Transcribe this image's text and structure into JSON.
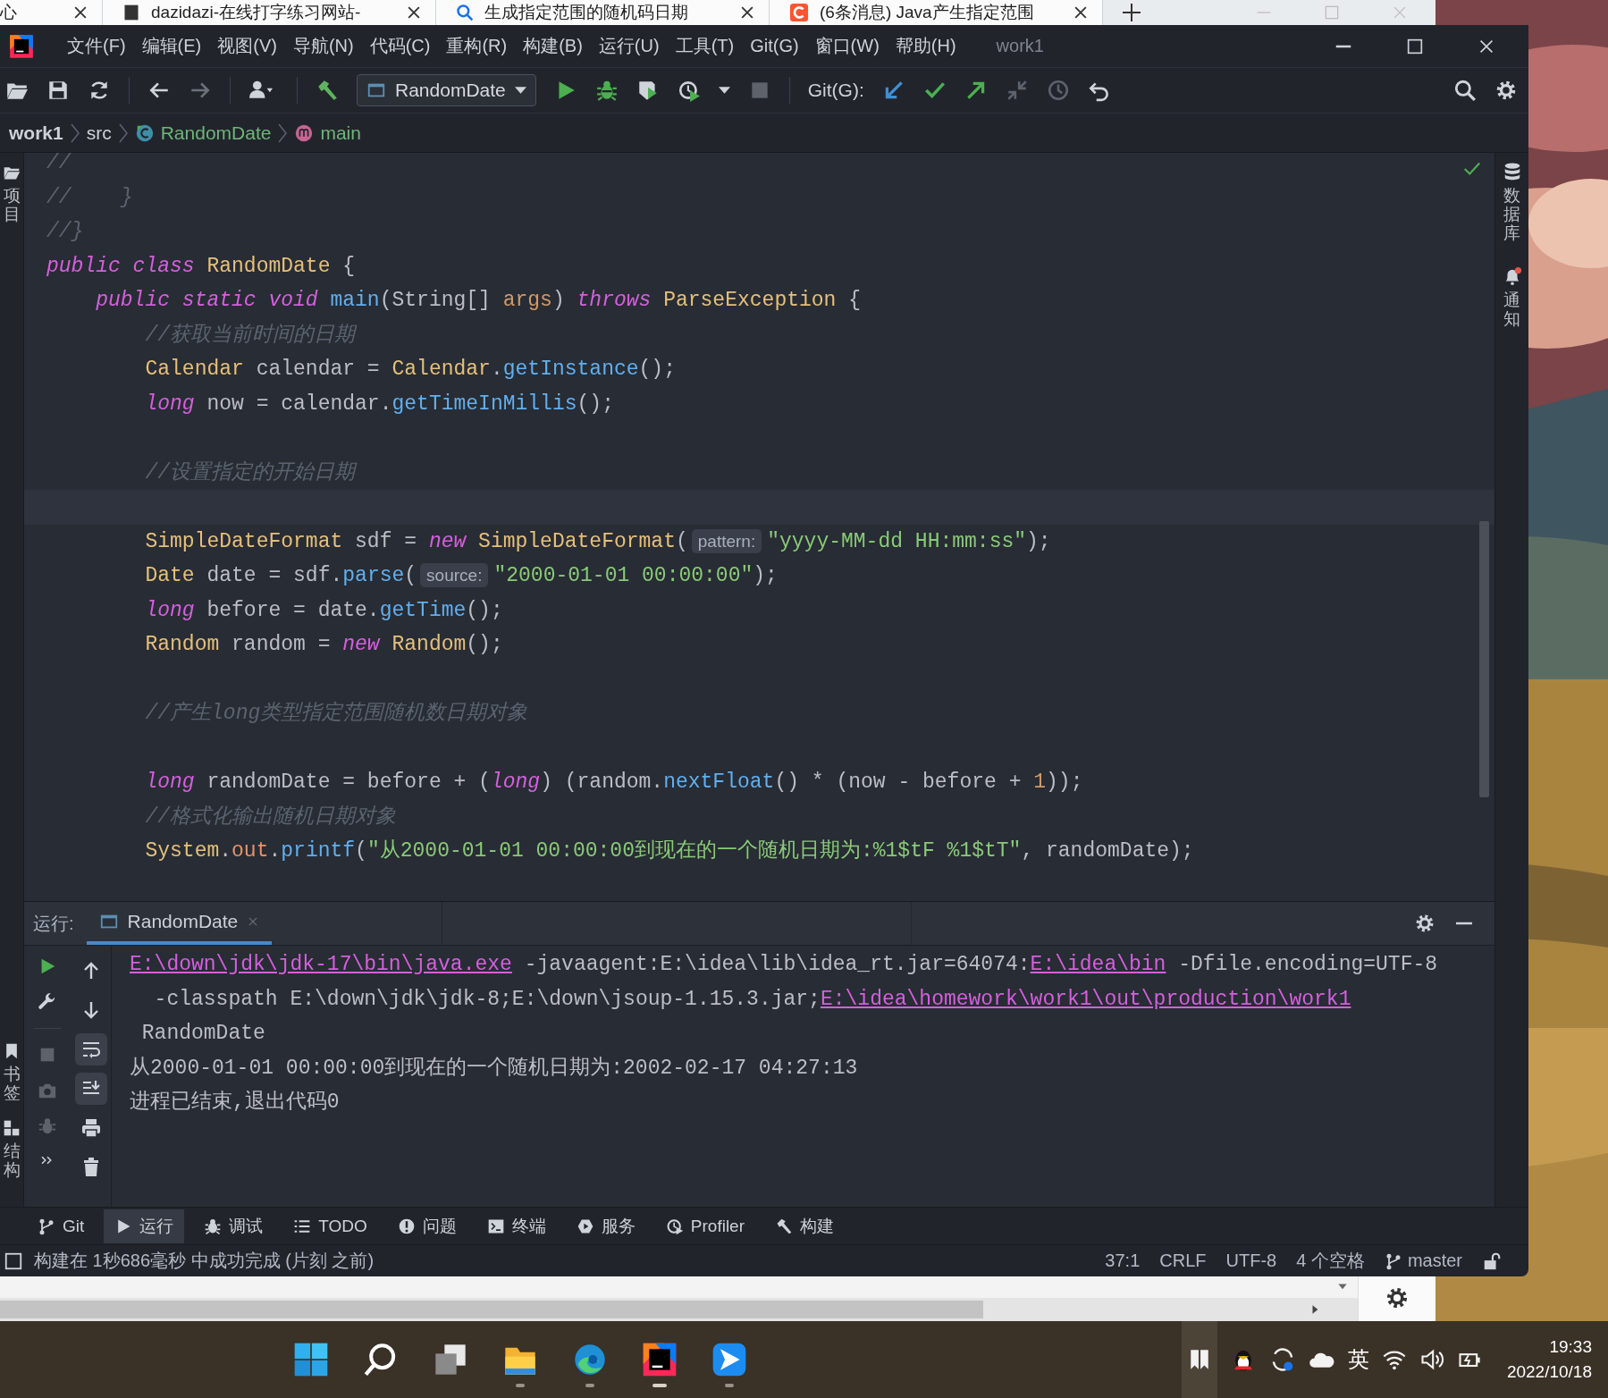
{
  "browser": {
    "tabs": [
      {
        "title": "心",
        "kind": "none"
      },
      {
        "title": "dazidazi-在线打字练习网站-",
        "kind": "page"
      },
      {
        "title": "生成指定范围的随机码日期",
        "kind": "search"
      },
      {
        "title": "(6条消息) Java产生指定范围",
        "kind": "csdn"
      }
    ]
  },
  "ide": {
    "menu": [
      "文件(F)",
      "编辑(E)",
      "视图(V)",
      "导航(N)",
      "代码(C)",
      "重构(R)",
      "构建(B)",
      "运行(U)",
      "工具(T)",
      "Git(G)",
      "窗口(W)",
      "帮助(H)"
    ],
    "title": "work1",
    "run_config": "RandomDate",
    "git_label": "Git(G):",
    "breadcrumb": [
      {
        "text": "work1",
        "kind": "project"
      },
      {
        "text": "src",
        "kind": "folder"
      },
      {
        "text": "RandomDate",
        "kind": "class"
      },
      {
        "text": "main",
        "kind": "method"
      }
    ],
    "left_top": [
      {
        "label": "项目",
        "kind": "folder"
      }
    ],
    "left_bottom": [
      {
        "label": "书签",
        "kind": "bookmark"
      },
      {
        "label": "结构",
        "kind": "structure"
      }
    ],
    "right_tools": [
      {
        "label": "数据库",
        "kind": "database"
      },
      {
        "label": "通知",
        "kind": "bell"
      }
    ],
    "editor": {
      "lines": [
        {
          "kind": "code",
          "tokens": [
            {
              "kind": "comment",
              "text": "//"
            }
          ]
        },
        {
          "kind": "code",
          "tokens": [
            {
              "kind": "comment",
              "text": "//    }"
            }
          ]
        },
        {
          "kind": "code",
          "tokens": [
            {
              "kind": "comment",
              "text": "//}"
            }
          ]
        },
        {
          "kind": "code",
          "tokens": [
            {
              "kind": "keyword",
              "text": "public class "
            },
            {
              "kind": "type",
              "text": "RandomDate"
            },
            {
              "kind": "plain",
              "text": " {"
            }
          ]
        },
        {
          "kind": "code",
          "tokens": [
            {
              "kind": "keyword",
              "text": "    public static void "
            },
            {
              "kind": "method",
              "text": "main"
            },
            {
              "kind": "plain",
              "text": "(String[] "
            },
            {
              "kind": "param",
              "text": "args"
            },
            {
              "kind": "plain",
              "text": ") "
            },
            {
              "kind": "keyword",
              "text": "throws "
            },
            {
              "kind": "type",
              "text": "ParseException"
            },
            {
              "kind": "plain",
              "text": " {"
            }
          ]
        },
        {
          "kind": "code",
          "tokens": [
            {
              "kind": "comment",
              "text": "        //获取当前时间的日期"
            }
          ]
        },
        {
          "kind": "code",
          "tokens": [
            {
              "kind": "type",
              "text": "        Calendar"
            },
            {
              "kind": "plain",
              "text": " calendar = "
            },
            {
              "kind": "type",
              "text": "Calendar"
            },
            {
              "kind": "plain",
              "text": "."
            },
            {
              "kind": "method",
              "text": "getInstance"
            },
            {
              "kind": "plain",
              "text": "();"
            }
          ]
        },
        {
          "kind": "code",
          "tokens": [
            {
              "kind": "keyword",
              "text": "        long"
            },
            {
              "kind": "plain",
              "text": " now = calendar."
            },
            {
              "kind": "method",
              "text": "getTimeInMillis"
            },
            {
              "kind": "plain",
              "text": "();"
            }
          ]
        },
        {
          "kind": "blank"
        },
        {
          "kind": "code",
          "tokens": [
            {
              "kind": "comment",
              "text": "        //设置指定的开始日期"
            }
          ]
        },
        {
          "kind": "caret-line"
        },
        {
          "kind": "code",
          "tokens": [
            {
              "kind": "type",
              "text": "        SimpleDateFormat"
            },
            {
              "kind": "plain",
              "text": " sdf = "
            },
            {
              "kind": "keyword",
              "text": "new "
            },
            {
              "kind": "type",
              "text": "SimpleDateFormat"
            },
            {
              "kind": "plain",
              "text": "("
            },
            {
              "kind": "hint",
              "text": "pattern:"
            },
            {
              "kind": "string",
              "text": "\"yyyy-MM-dd HH:mm:ss\""
            },
            {
              "kind": "plain",
              "text": ");"
            }
          ]
        },
        {
          "kind": "code",
          "tokens": [
            {
              "kind": "type",
              "text": "        Date"
            },
            {
              "kind": "plain",
              "text": " date = sdf."
            },
            {
              "kind": "method",
              "text": "parse"
            },
            {
              "kind": "plain",
              "text": "("
            },
            {
              "kind": "hint",
              "text": "source:"
            },
            {
              "kind": "string",
              "text": "\"2000-01-01 00:00:00\""
            },
            {
              "kind": "plain",
              "text": ");"
            }
          ]
        },
        {
          "kind": "code",
          "tokens": [
            {
              "kind": "keyword",
              "text": "        long"
            },
            {
              "kind": "plain",
              "text": " before = date."
            },
            {
              "kind": "method",
              "text": "getTime"
            },
            {
              "kind": "plain",
              "text": "();"
            }
          ]
        },
        {
          "kind": "code",
          "tokens": [
            {
              "kind": "type",
              "text": "        Random"
            },
            {
              "kind": "plain",
              "text": " random = "
            },
            {
              "kind": "keyword",
              "text": "new "
            },
            {
              "kind": "type",
              "text": "Random"
            },
            {
              "kind": "plain",
              "text": "();"
            }
          ]
        },
        {
          "kind": "blank"
        },
        {
          "kind": "code",
          "tokens": [
            {
              "kind": "comment",
              "text": "        //产生long类型指定范围随机数日期对象"
            }
          ]
        },
        {
          "kind": "blank"
        },
        {
          "kind": "code",
          "tokens": [
            {
              "kind": "keyword",
              "text": "        long"
            },
            {
              "kind": "plain",
              "text": " randomDate = before + ("
            },
            {
              "kind": "keyword",
              "text": "long"
            },
            {
              "kind": "plain",
              "text": ") (random."
            },
            {
              "kind": "method",
              "text": "nextFloat"
            },
            {
              "kind": "plain",
              "text": "() * (now - before + "
            },
            {
              "kind": "number",
              "text": "1"
            },
            {
              "kind": "plain",
              "text": "));"
            }
          ]
        },
        {
          "kind": "code",
          "tokens": [
            {
              "kind": "comment",
              "text": "        //格式化输出随机日期对象"
            }
          ]
        },
        {
          "kind": "code",
          "tokens": [
            {
              "kind": "type",
              "text": "        System"
            },
            {
              "kind": "plain",
              "text": "."
            },
            {
              "kind": "field",
              "text": "out"
            },
            {
              "kind": "plain",
              "text": "."
            },
            {
              "kind": "method",
              "text": "printf"
            },
            {
              "kind": "plain",
              "text": "("
            },
            {
              "kind": "string",
              "text": "\"从2000-01-01 00:00:00到现在的一个随机日期为:%1$tF %1$tT\""
            },
            {
              "kind": "plain",
              "text": ", randomDate);"
            }
          ]
        },
        {
          "kind": "blank"
        }
      ]
    },
    "run_panel": {
      "label": "运行:",
      "tabs": [
        {
          "title": "RandomDate",
          "selected": true
        }
      ],
      "actions": [
        {
          "kind": "up",
          "on": false
        },
        {
          "kind": "down",
          "on": false
        },
        {
          "kind": "wrap",
          "on": true
        },
        {
          "kind": "scroll-end",
          "on": true
        },
        {
          "kind": "print",
          "on": false
        },
        {
          "kind": "trash",
          "on": false
        }
      ],
      "console": [
        {
          "segments": [
            {
              "kind": "link",
              "text": "E:\\down\\jdk\\jdk-17\\bin\\java.exe"
            },
            {
              "kind": "plain",
              "text": " -javaagent:E:\\idea\\lib\\idea_rt.jar=64074:"
            },
            {
              "kind": "link",
              "text": "E:\\idea\\bin"
            },
            {
              "kind": "plain",
              "text": " -Dfile.encoding=UTF-8"
            }
          ]
        },
        {
          "segments": [
            {
              "kind": "plain",
              "text": "  -classpath E:\\down\\jdk\\jdk-8;E:\\down\\jsoup-1.15.3.jar;"
            },
            {
              "kind": "link",
              "text": "E:\\idea\\homework\\work1\\out\\production\\work1"
            }
          ]
        },
        {
          "segments": [
            {
              "kind": "plain",
              "text": " RandomDate"
            }
          ]
        },
        {
          "segments": [
            {
              "kind": "plain",
              "text": "从2000-01-01 00:00:00到现在的一个随机日期为:2002-02-17 04:27:13"
            }
          ]
        },
        {
          "segments": [
            {
              "kind": "plain",
              "text": "进程已结束,退出代码0"
            }
          ]
        }
      ]
    },
    "tool_windows": [
      {
        "label": "Git",
        "kind": "branch",
        "selected": false
      },
      {
        "label": "运行",
        "kind": "play",
        "selected": true
      },
      {
        "label": "调试",
        "kind": "bug",
        "selected": false
      },
      {
        "label": "TODO",
        "kind": "list",
        "selected": false
      },
      {
        "label": "问题",
        "kind": "info",
        "selected": false
      },
      {
        "label": "终端",
        "kind": "terminal",
        "selected": false
      },
      {
        "label": "服务",
        "kind": "service",
        "selected": false
      },
      {
        "label": "Profiler",
        "kind": "profiler",
        "selected": false
      },
      {
        "label": "构建",
        "kind": "hammer",
        "selected": false
      }
    ],
    "status": {
      "message": "构建在 1秒686毫秒 中成功完成 (片刻 之前)",
      "items": [
        "37:1",
        "CRLF",
        "UTF-8",
        "4 个空格"
      ],
      "branch": "master"
    }
  },
  "taskbar": {
    "apps": [
      {
        "kind": "start",
        "running": false,
        "selected": false
      },
      {
        "kind": "search",
        "running": false,
        "selected": false
      },
      {
        "kind": "taskview",
        "running": false,
        "selected": false
      },
      {
        "kind": "files",
        "running": true,
        "selected": false
      },
      {
        "kind": "edge",
        "running": true,
        "selected": false
      },
      {
        "kind": "ide",
        "running": true,
        "selected": true
      },
      {
        "kind": "messenger",
        "running": true,
        "selected": false
      }
    ],
    "language": "英",
    "time": "19:33",
    "date": "2022/10/18"
  }
}
